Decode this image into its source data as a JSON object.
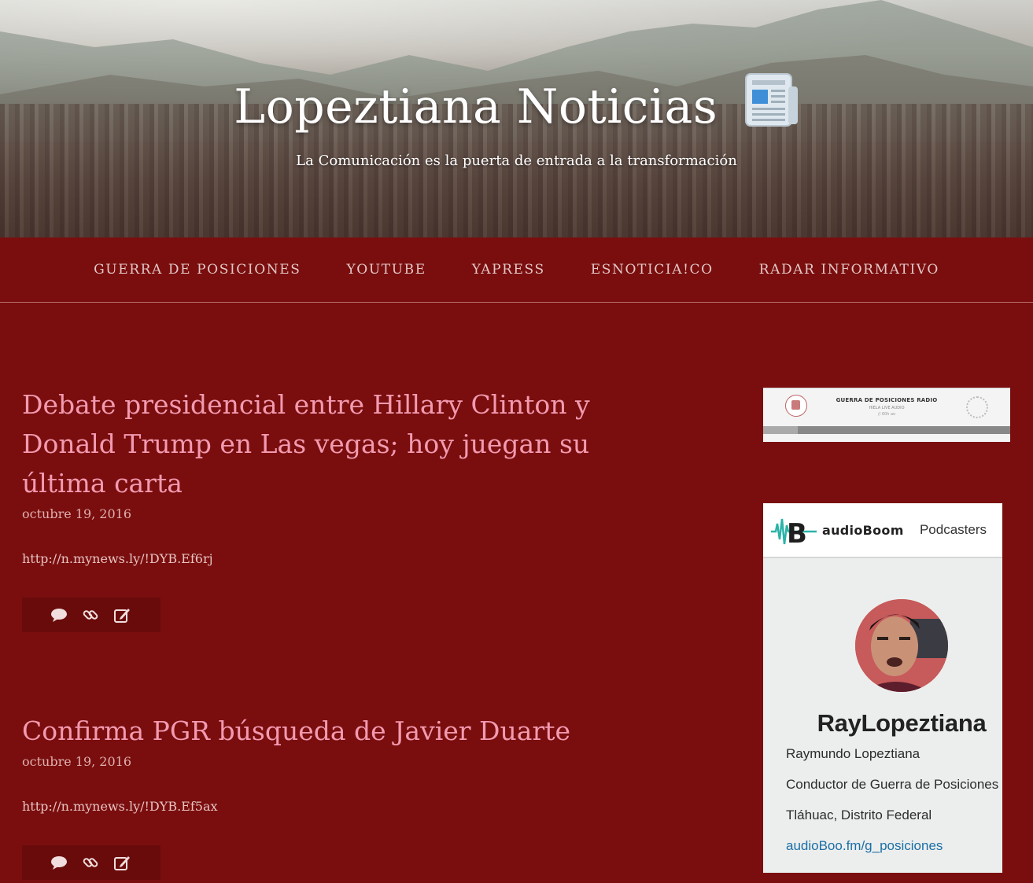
{
  "header": {
    "title": "Lopeztiana Noticias",
    "tagline": "La Comunicación es la puerta de entrada a la transformación",
    "title_icon": "newspaper-icon"
  },
  "nav": {
    "items": [
      {
        "label": "GUERRA DE POSICIONES"
      },
      {
        "label": "YOUTUBE"
      },
      {
        "label": "YAPRESS"
      },
      {
        "label": "ESNOTICIA!CO"
      },
      {
        "label": "RADAR INFORMATIVO"
      }
    ]
  },
  "posts": [
    {
      "title": "Debate presidencial entre Hillary Clinton y Donald Trump en Las vegas; hoy juegan su última carta",
      "date": "octubre 19, 2016",
      "link": "http://n.mynews.ly/!DYB.Ef6rj",
      "actions": [
        "comment-icon",
        "link-icon",
        "edit-icon"
      ]
    },
    {
      "title": "Confirma PGR búsqueda de Javier Duarte",
      "date": "octubre 19, 2016",
      "link": "http://n.mynews.ly/!DYB.Ef5ax",
      "actions": [
        "comment-icon",
        "link-icon",
        "edit-icon"
      ]
    }
  ],
  "sidebar": {
    "radio": {
      "title": "GUERRA DE POSICIONES RADIO",
      "subtitle": "HIELA LIVE AUDIO",
      "time": "// 60h ao"
    },
    "audioboom": {
      "brand": "audioBoom",
      "nav_label": "Podcasters",
      "username": "RayLopeztiana",
      "full_name": "Raymundo Lopeztiana",
      "role": "Conductor de Guerra de Posiciones",
      "location": "Tláhuac, Distrito Federal",
      "url": "audioBoo.fm/g_posiciones"
    }
  },
  "colors": {
    "background": "#7a0e0e",
    "post_title": "#f29ab0",
    "nav_text": "#e2c7c7",
    "link_blue": "#1b6fa6"
  }
}
